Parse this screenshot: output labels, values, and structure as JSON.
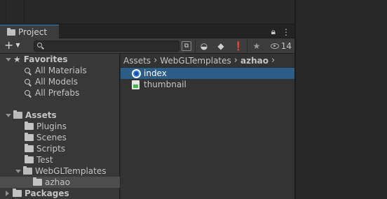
{
  "panel": {
    "tab_label": "Project"
  },
  "toolbar": {
    "add_icon": "plus-icon",
    "search_placeholder": "",
    "hidden_count": "14"
  },
  "favorites": {
    "label": "Favorites",
    "items": [
      {
        "label": "All Materials"
      },
      {
        "label": "All Models"
      },
      {
        "label": "All Prefabs"
      }
    ]
  },
  "assets": {
    "label": "Assets",
    "items": [
      {
        "label": "Plugins"
      },
      {
        "label": "Scenes"
      },
      {
        "label": "Scripts"
      },
      {
        "label": "Test"
      },
      {
        "label": "WebGLTemplates"
      }
    ],
    "sub_item": {
      "label": "azhao"
    }
  },
  "packages": {
    "label": "Packages"
  },
  "breadcrumb": {
    "items": [
      "Assets",
      "WebGLTemplates",
      "azhao"
    ]
  },
  "files": [
    {
      "label": "index",
      "selected": true
    },
    {
      "label": "thumbnail",
      "selected": false
    }
  ],
  "colors": {
    "selection": "#2c5d87",
    "tab_accent": "#2c5d87"
  }
}
